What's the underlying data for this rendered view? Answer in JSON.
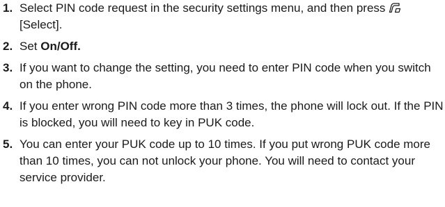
{
  "steps": [
    {
      "number": "1.",
      "text_before_icon": "Select PIN code request in the security settings menu, and then press",
      "icon": "soft-key-select-icon",
      "text_after_icon": "[Select]."
    },
    {
      "number": "2.",
      "text": "Set ",
      "bold_text": "On/Off."
    },
    {
      "number": "3.",
      "text": "If you want to change the setting, you need to enter PIN code when you switch on the phone."
    },
    {
      "number": "4.",
      "text": "If you enter wrong PIN code more than 3 times, the phone will lock out. If the PIN is blocked, you will need to key in PUK code."
    },
    {
      "number": "5.",
      "text": "You can enter your PUK code up to 10 times. If you put wrong PUK code more than 10 times, you can not unlock your phone. You will need to contact your service provider."
    }
  ]
}
